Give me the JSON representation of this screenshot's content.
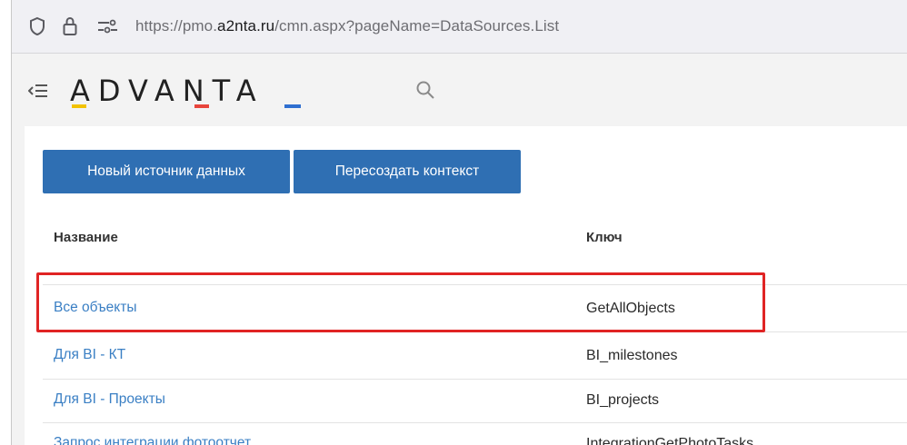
{
  "browser": {
    "url_prefix": "https://pmo.",
    "url_domain": "a2nta.ru",
    "url_suffix": "/cmn.aspx?pageName=DataSources.List"
  },
  "header": {
    "logo_text": "ADVANTA"
  },
  "toolbar": {
    "new_source_label": "Новый источник данных",
    "recreate_context_label": "Пересоздать контекст"
  },
  "table": {
    "columns": [
      "Название",
      "Ключ"
    ],
    "rows": [
      {
        "name": "Все объекты",
        "key": "GetAllObjects"
      },
      {
        "name": "Для BI - КТ",
        "key": "BI_milestones"
      },
      {
        "name": "Для BI - Проекты",
        "key": "BI_projects"
      },
      {
        "name": "Запрос интеграции фотоотчет",
        "key": "IntegrationGetPhotoTasks"
      }
    ]
  },
  "colors": {
    "accent": "#2f6fb3",
    "link": "#3a7fc4",
    "highlight": "#e02424",
    "logo_yellow": "#f2c200",
    "logo_red": "#e8453c",
    "logo_blue": "#2f6fd0"
  },
  "icons": {
    "shield": "shield-icon",
    "lock": "lock-icon",
    "permissions": "permissions-icon",
    "menu_toggle": "menu-collapse-icon",
    "search": "search-icon"
  }
}
